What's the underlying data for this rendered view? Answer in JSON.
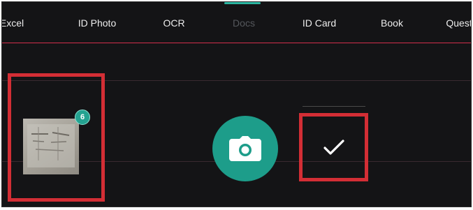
{
  "tabs": [
    {
      "label": "Excel",
      "active": false
    },
    {
      "label": "ID Photo",
      "active": false
    },
    {
      "label": "OCR",
      "active": false
    },
    {
      "label": "Docs",
      "active": true
    },
    {
      "label": "ID Card",
      "active": false
    },
    {
      "label": "Book",
      "active": false
    },
    {
      "label": "Quest",
      "active": false
    }
  ],
  "thumbnail": {
    "badge_count": "6",
    "icon": "scanned-document-thumbnail"
  },
  "capture_button": {
    "icon": "camera-icon",
    "color": "#1d9d8a"
  },
  "confirm_button": {
    "icon": "checkmark-icon"
  },
  "colors": {
    "accent": "#1d9d8a",
    "highlight_border": "#d32e35",
    "guide_line": "#d32e4b",
    "background": "#141416"
  }
}
